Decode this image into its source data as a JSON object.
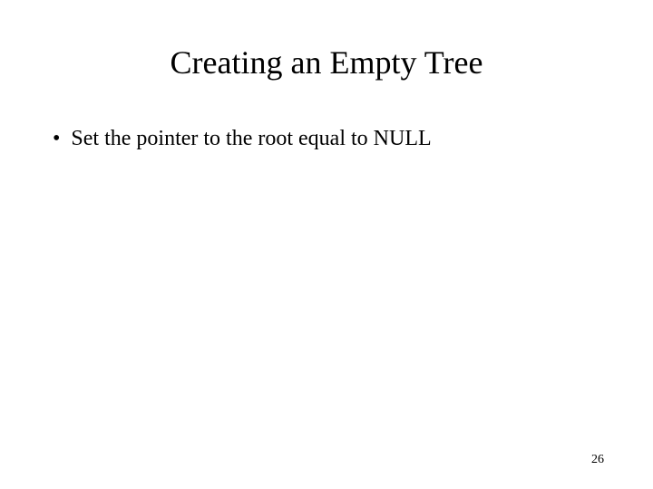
{
  "slide": {
    "title": "Creating an Empty Tree",
    "bullets": [
      "Set the pointer to the root equal to NULL"
    ],
    "page_number": "26"
  }
}
